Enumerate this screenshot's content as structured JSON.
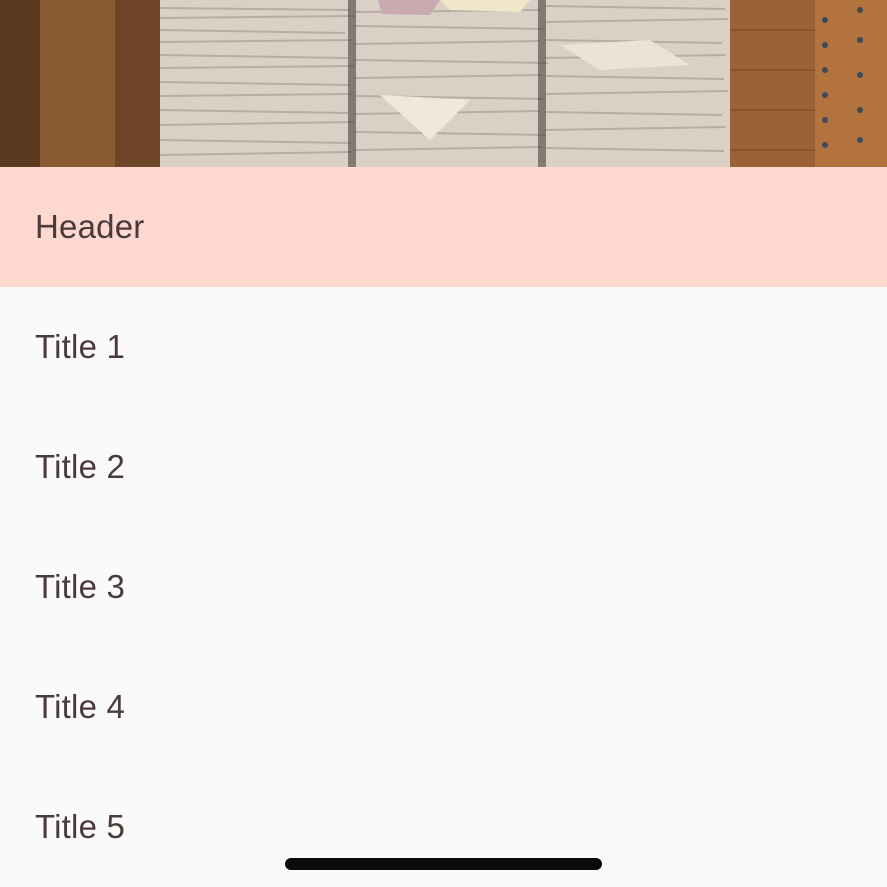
{
  "header": {
    "title": "Header"
  },
  "list": {
    "items": [
      {
        "label": "Title 1"
      },
      {
        "label": "Title 2"
      },
      {
        "label": "Title 3"
      },
      {
        "label": "Title 4"
      },
      {
        "label": "Title 5"
      }
    ]
  },
  "colors": {
    "header_background": "#ffd8d0",
    "list_background": "#fafafa",
    "text": "#4a3a3a",
    "home_indicator": "#0a0a0a"
  }
}
